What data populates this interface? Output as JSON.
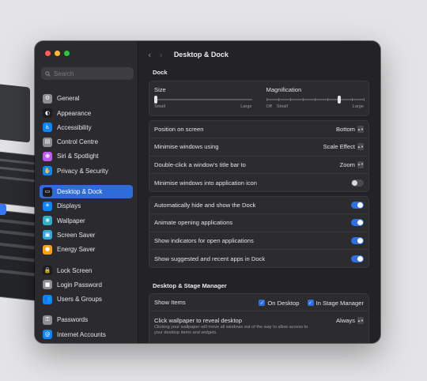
{
  "window": {
    "title": "Desktop & Dock"
  },
  "search": {
    "placeholder": "Search"
  },
  "sidebar": {
    "items": [
      {
        "label": "General",
        "icon": "gear-icon",
        "color": "#8e8e93",
        "glyph": "⚙"
      },
      {
        "label": "Appearance",
        "icon": "appearance-icon",
        "color": "#1c1c1e",
        "glyph": "◐"
      },
      {
        "label": "Accessibility",
        "icon": "accessibility-icon",
        "color": "#0a84ff",
        "glyph": "♿"
      },
      {
        "label": "Control Centre",
        "icon": "control-centre-icon",
        "color": "#8e8e93",
        "glyph": "▤"
      },
      {
        "label": "Siri & Spotlight",
        "icon": "siri-icon",
        "color": "#bf5af2",
        "glyph": "◉"
      },
      {
        "label": "Privacy & Security",
        "icon": "hand-icon",
        "color": "#0a84ff",
        "glyph": "✋"
      },
      {
        "label": "Desktop & Dock",
        "icon": "dock-icon",
        "color": "#1c1c1e",
        "glyph": "▭"
      },
      {
        "label": "Displays",
        "icon": "displays-icon",
        "color": "#0a84ff",
        "glyph": "☀"
      },
      {
        "label": "Wallpaper",
        "icon": "wallpaper-icon",
        "color": "#30b0c7",
        "glyph": "❀"
      },
      {
        "label": "Screen Saver",
        "icon": "screen-saver-icon",
        "color": "#34aadc",
        "glyph": "▣"
      },
      {
        "label": "Energy Saver",
        "icon": "energy-icon",
        "color": "#ff9f0a",
        "glyph": "●"
      },
      {
        "label": "Lock Screen",
        "icon": "lock-screen-icon",
        "color": "#1c1c1e",
        "glyph": "🔒"
      },
      {
        "label": "Login Password",
        "icon": "lock-icon",
        "color": "#8e8e93",
        "glyph": "■"
      },
      {
        "label": "Users & Groups",
        "icon": "users-icon",
        "color": "#0a84ff",
        "glyph": "👥"
      },
      {
        "label": "Passwords",
        "icon": "key-icon",
        "color": "#8e8e93",
        "glyph": "⚿"
      },
      {
        "label": "Internet Accounts",
        "icon": "at-icon",
        "color": "#0a84ff",
        "glyph": "@"
      }
    ]
  },
  "dock": {
    "section_title": "Dock",
    "size_label": "Size",
    "size_min": "Small",
    "size_max": "Large",
    "size_value": 0.02,
    "magnification_label": "Magnification",
    "mag_off": "Off",
    "mag_min": "Small",
    "mag_max": "Large",
    "magnification_value": 0.75,
    "position_label": "Position on screen",
    "position_value": "Bottom",
    "minimise_label": "Minimise windows using",
    "minimise_value": "Scale Effect",
    "dblclick_label": "Double-click a window's title bar to",
    "dblclick_value": "Zoom",
    "minimise_into_label": "Minimise windows into application icon",
    "autohide_label": "Automatically hide and show the Dock",
    "animate_label": "Animate opening applications",
    "indicators_label": "Show indicators for open applications",
    "suggested_label": "Show suggested and recent apps in Dock"
  },
  "stage": {
    "section_title": "Desktop & Stage Manager",
    "show_items_label": "Show Items",
    "on_desktop_label": "On Desktop",
    "in_stage_manager_label": "In Stage Manager",
    "click_wallpaper_label": "Click wallpaper to reveal desktop",
    "click_wallpaper_value": "Always",
    "click_wallpaper_desc": "Clicking your wallpaper will move all windows out of the way to allow access to your desktop items and widgets."
  },
  "colors": {
    "accent": "#2f6fe0",
    "sidebar_active": "#2e6dd9"
  }
}
